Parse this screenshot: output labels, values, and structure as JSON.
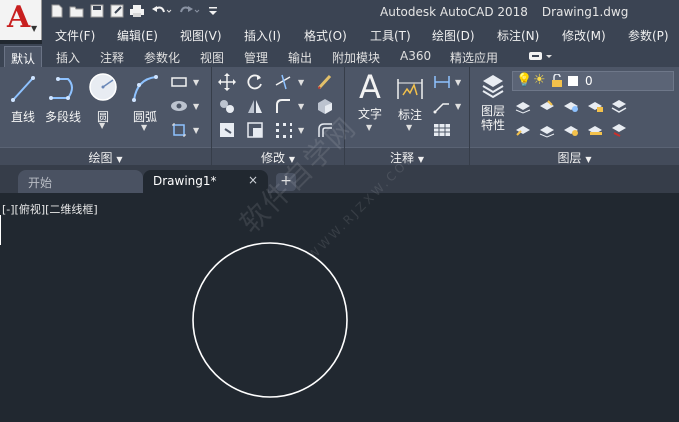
{
  "titlebar": {
    "app_name": "Autodesk AutoCAD 2018",
    "document": "Drawing1.dwg",
    "app_letter": "A"
  },
  "quick_access": [
    "new-icon",
    "open-icon",
    "save-icon",
    "saveas-icon",
    "print-icon",
    "undo-icon",
    "redo-icon",
    "customize-icon"
  ],
  "menu": [
    {
      "label": "文件(F)"
    },
    {
      "label": "编辑(E)"
    },
    {
      "label": "视图(V)"
    },
    {
      "label": "插入(I)"
    },
    {
      "label": "格式(O)"
    },
    {
      "label": "工具(T)"
    },
    {
      "label": "绘图(D)"
    },
    {
      "label": "标注(N)"
    },
    {
      "label": "修改(M)"
    },
    {
      "label": "参数(P)"
    }
  ],
  "ribbon_tabs": [
    {
      "label": "默认",
      "active": true
    },
    {
      "label": "插入"
    },
    {
      "label": "注释"
    },
    {
      "label": "参数化"
    },
    {
      "label": "视图"
    },
    {
      "label": "管理"
    },
    {
      "label": "输出"
    },
    {
      "label": "附加模块"
    },
    {
      "label": "A360"
    },
    {
      "label": "精选应用"
    }
  ],
  "panels": {
    "draw": {
      "title": "绘图",
      "tools": [
        {
          "label": "直线"
        },
        {
          "label": "多段线"
        },
        {
          "label": "圆"
        },
        {
          "label": "圆弧"
        }
      ]
    },
    "modify": {
      "title": "修改"
    },
    "annotation": {
      "title": "注释",
      "tools": [
        {
          "label": "文字"
        },
        {
          "label": "标注"
        }
      ]
    },
    "layers": {
      "title": "图层",
      "properties_label_1": "图层",
      "properties_label_2": "特性",
      "current_layer": "0"
    }
  },
  "doc_tabs": {
    "start": "开始",
    "current": "Drawing1*",
    "close": "×",
    "add": "+"
  },
  "canvas": {
    "view_label": "[-][俯视][二维线框]",
    "watermark": "软件自学网",
    "watermark_url": "WWW.RJZXW.COM",
    "accent": "#ffffff",
    "background": "#212830"
  }
}
